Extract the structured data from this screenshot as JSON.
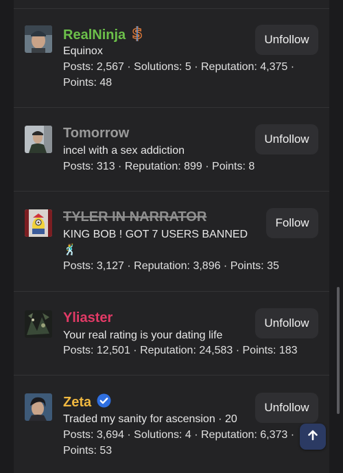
{
  "users": [
    {
      "name": "RealNinja",
      "name_color": "#6cc04a",
      "badge_icon": "dollar-badge-icon",
      "subtitle": "Equinox",
      "stats_line1": "Posts: 2,567 · Solutions: 5 · Reputation: 4,375 ·",
      "stats_line2": "Points: 48",
      "button": "Unfollow"
    },
    {
      "name": "Tomorrow",
      "name_color": "#9a9a9a",
      "subtitle": "incel with a sex addiction",
      "stats_line1": "Posts: 313 · Reputation: 899 · Points: 8",
      "button": "Unfollow"
    },
    {
      "name": "TYLER IN NARRATOR",
      "name_color": "#8f8f8f",
      "subtitle": "KING BOB ! GOT 7 USERS BANNED",
      "subtitle_emoji": "🕺",
      "stats_line1": "Posts: 3,127 · Reputation: 3,896 · Points: 35",
      "button": "Follow"
    },
    {
      "name": "Yliaster",
      "name_color": "#e23a66",
      "subtitle": "Your real rating is your dating life",
      "stats_line1": "Posts: 12,501 · Reputation: 24,583 · Points: 183",
      "button": "Unfollow"
    },
    {
      "name": "Zeta",
      "name_color": "#f0b840",
      "badge_icon": "verified-check-icon",
      "subtitle": "Traded my sanity for ascension · 20",
      "stats_line1": "Posts: 3,694 · Solutions: 4 · Reputation: 6,373 ·",
      "stats_line2": "Points: 53",
      "button": "Unfollow"
    }
  ],
  "colors": {
    "background": "#1b1b1d",
    "panel": "#232325",
    "button": "#2f2f32",
    "scroll_top_button": "#2b3a63",
    "verified": "#2f6fe0"
  }
}
